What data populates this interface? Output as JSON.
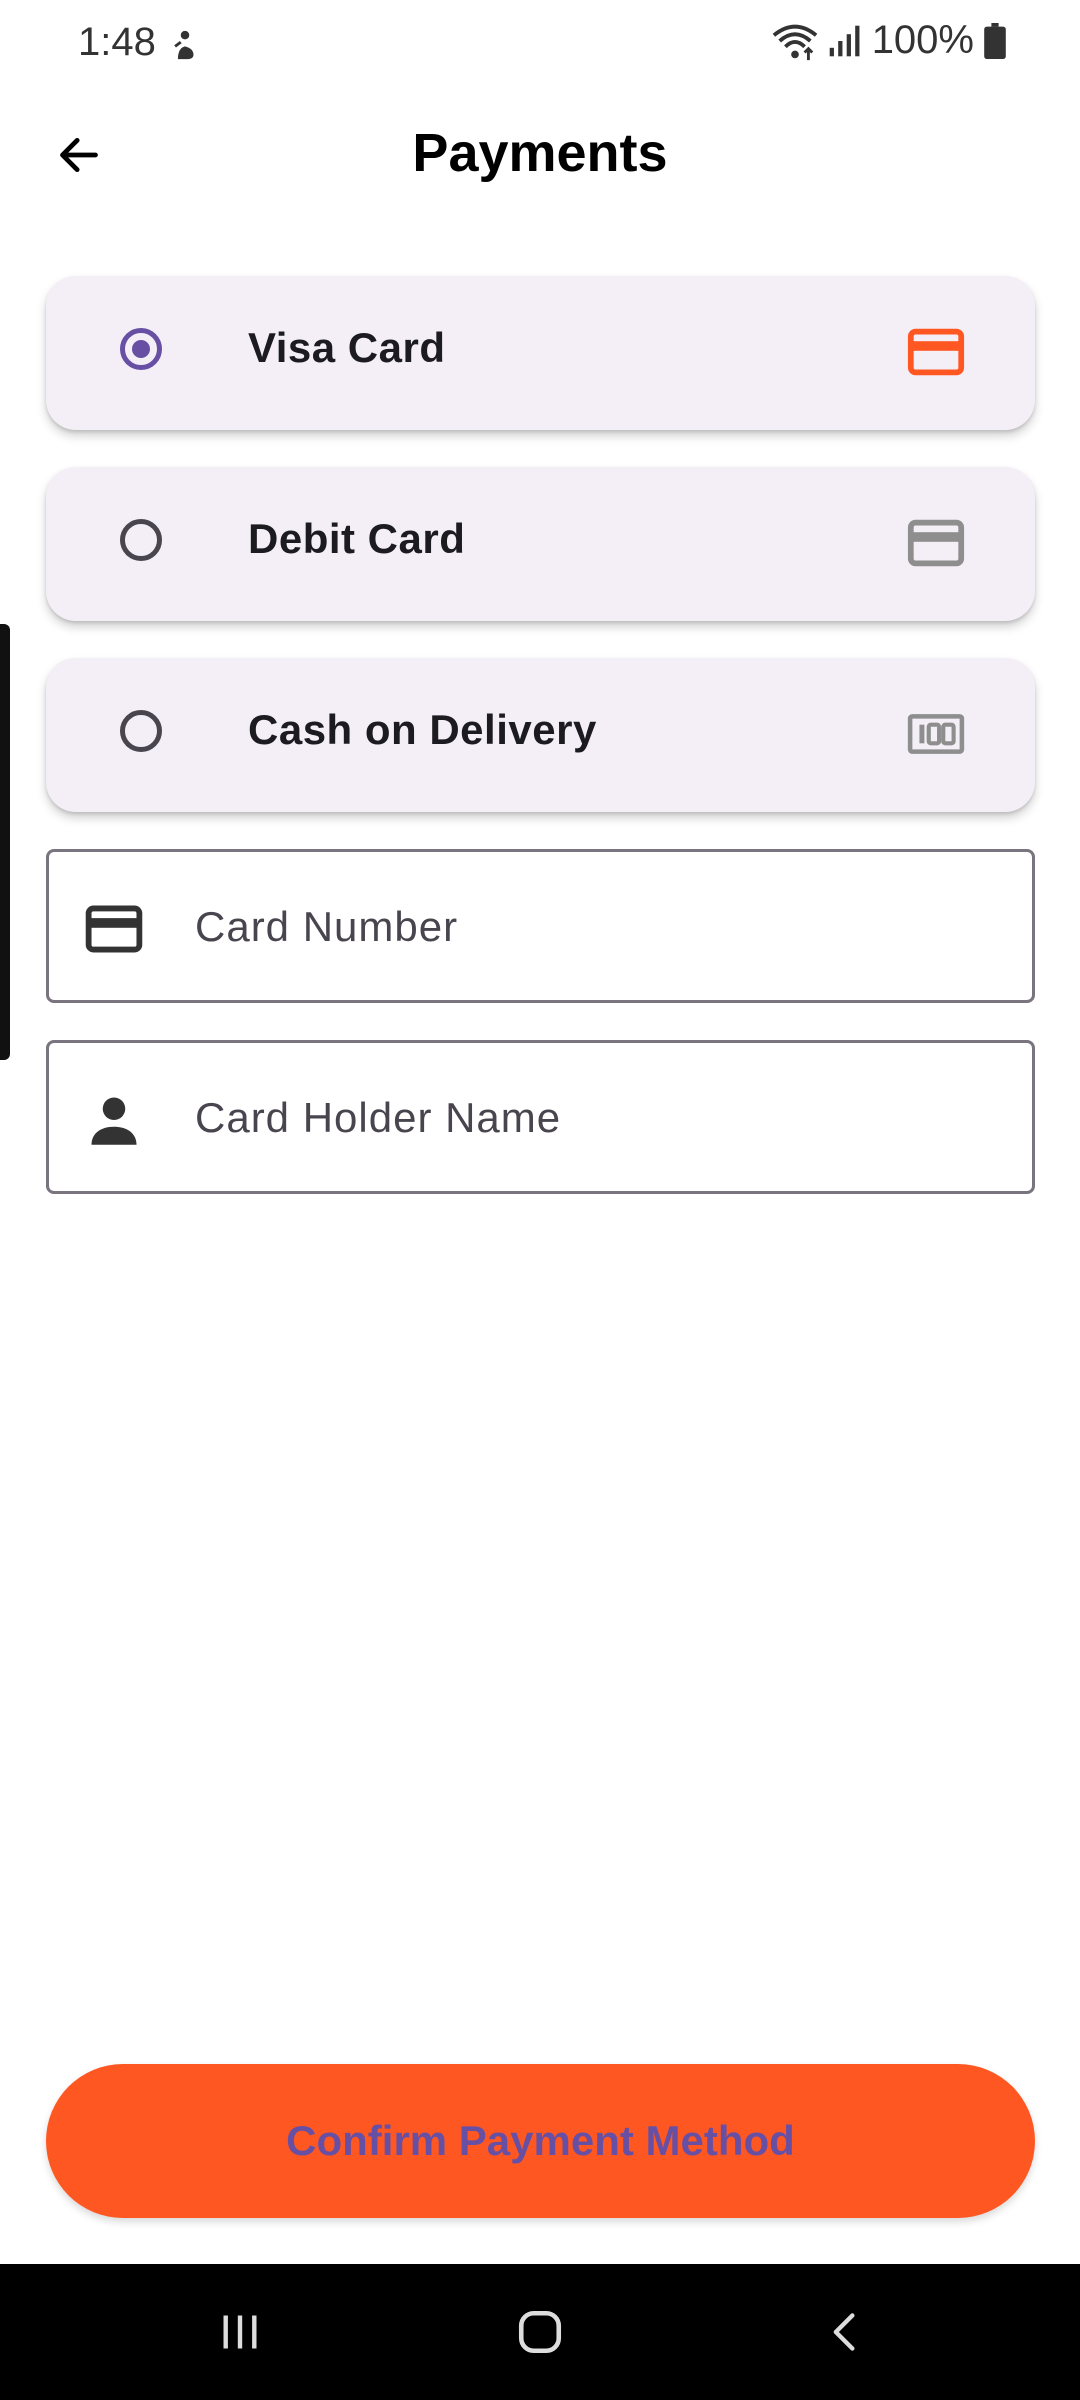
{
  "status_bar": {
    "time": "1:48",
    "battery": "100%"
  },
  "header": {
    "title": "Payments"
  },
  "payment_options": [
    {
      "label": "Visa Card",
      "selected": true,
      "icon": "credit-card-icon",
      "icon_color": "#ff5722"
    },
    {
      "label": "Debit Card",
      "selected": false,
      "icon": "credit-card-icon",
      "icon_color": "#8e8e8e"
    },
    {
      "label": "Cash on Delivery",
      "selected": false,
      "icon": "money-icon",
      "icon_color": "#8e8e8e"
    }
  ],
  "form": {
    "card_number_placeholder": "Card Number",
    "card_holder_placeholder": "Card Holder Name"
  },
  "confirm": {
    "label": "Confirm Payment Method"
  },
  "colors": {
    "accent": "#ff5722",
    "primary": "#6750a4",
    "card_bg": "#f4eff7"
  }
}
